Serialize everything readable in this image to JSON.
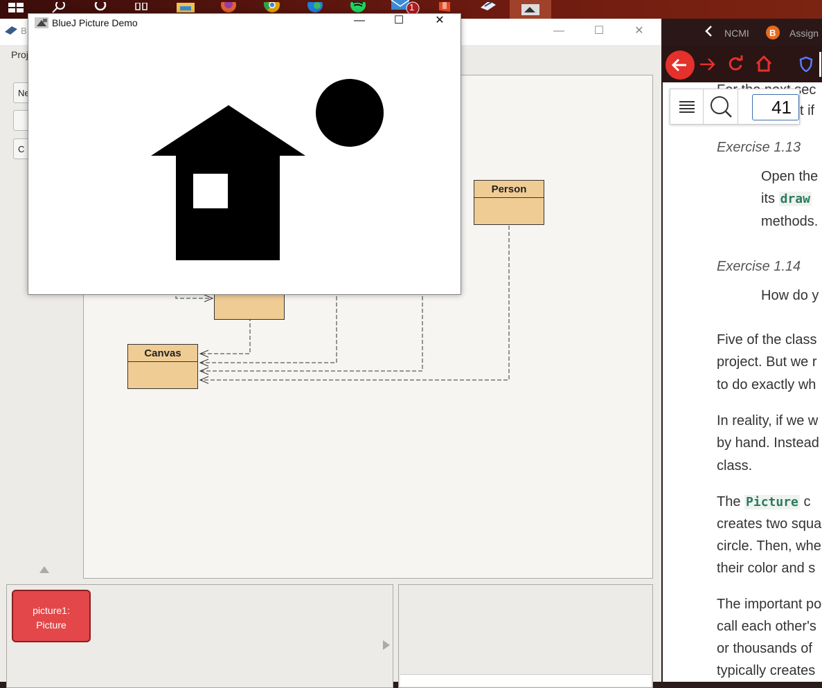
{
  "taskbar": {
    "mail_badge": "1"
  },
  "bluej_main": {
    "title": "B",
    "menu_project": "Proj",
    "side_buttons": [
      "Ne",
      "",
      "C"
    ],
    "classes": [
      {
        "name": "Person"
      },
      {
        "name": ""
      },
      {
        "name": "Canvas"
      }
    ],
    "object_bench": {
      "object_label_line1": "picture1:",
      "object_label_line2": "Picture"
    }
  },
  "picture_demo": {
    "title": "BlueJ Picture Demo"
  },
  "browser": {
    "tab1": "NCMI",
    "tab2": "Assign",
    "page_number": "41",
    "colors": {
      "accent": "#e4312b",
      "link": "#2c7a5d"
    }
  },
  "reader": {
    "top_partial": "For the next sec",
    "top_partial2": "ct if",
    "exercise_113": "Exercise 1.13",
    "ex113_line1": "Open the",
    "ex113_line2_prefix": "its",
    "ex113_line2_code": "draw",
    "ex113_line3": "methods.",
    "exercise_114": "Exercise 1.14",
    "ex114_line1": "How do y",
    "p1_l1": "Five of the class",
    "p1_l2": "project. But we r",
    "p1_l3": "to do exactly wh",
    "p2_l1": "In reality, if we w",
    "p2_l2": "by hand. Instead",
    "p2_l3": "class.",
    "p3_l1_prefix": "The",
    "p3_l1_code": "Picture",
    "p3_l1_suffix": "c",
    "p3_l2": "creates two squa",
    "p3_l3": "circle. Then, whe",
    "p3_l4": "their color and s",
    "p4_l1": "The important po",
    "p4_l2": "call each other's",
    "p4_l3": "or thousands of",
    "p4_l4": "typically creates"
  }
}
